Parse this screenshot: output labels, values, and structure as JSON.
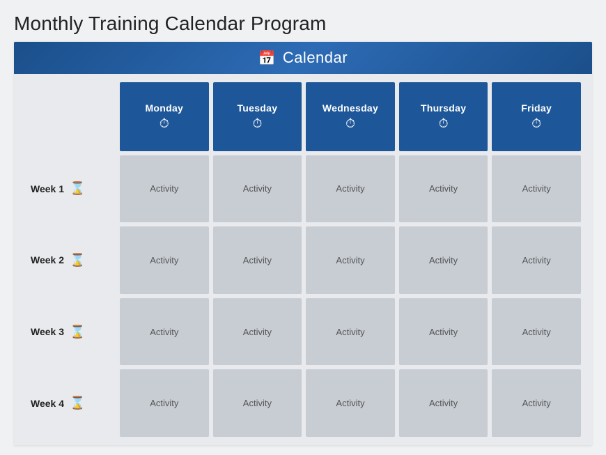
{
  "title": "Monthly Training Calendar Program",
  "calendar": {
    "label": "Calendar",
    "days": [
      {
        "name": "Monday",
        "icon": "⏱"
      },
      {
        "name": "Tuesday",
        "icon": "⏱"
      },
      {
        "name": "Wednesday",
        "icon": "⏱"
      },
      {
        "name": "Thursday",
        "icon": "⏱"
      },
      {
        "name": "Friday",
        "icon": "⏱"
      }
    ],
    "weeks": [
      {
        "label": "Week 1",
        "activities": [
          "Activity",
          "Activity",
          "Activity",
          "Activity",
          "Activity"
        ]
      },
      {
        "label": "Week 2",
        "activities": [
          "Activity",
          "Activity",
          "Activity",
          "Activity",
          "Activity"
        ]
      },
      {
        "label": "Week 3",
        "activities": [
          "Activity",
          "Activity",
          "Activity",
          "Activity",
          "Activity"
        ]
      },
      {
        "label": "Week 4",
        "activities": [
          "Activity",
          "Activity",
          "Activity",
          "Activity",
          "Activity"
        ]
      }
    ]
  }
}
